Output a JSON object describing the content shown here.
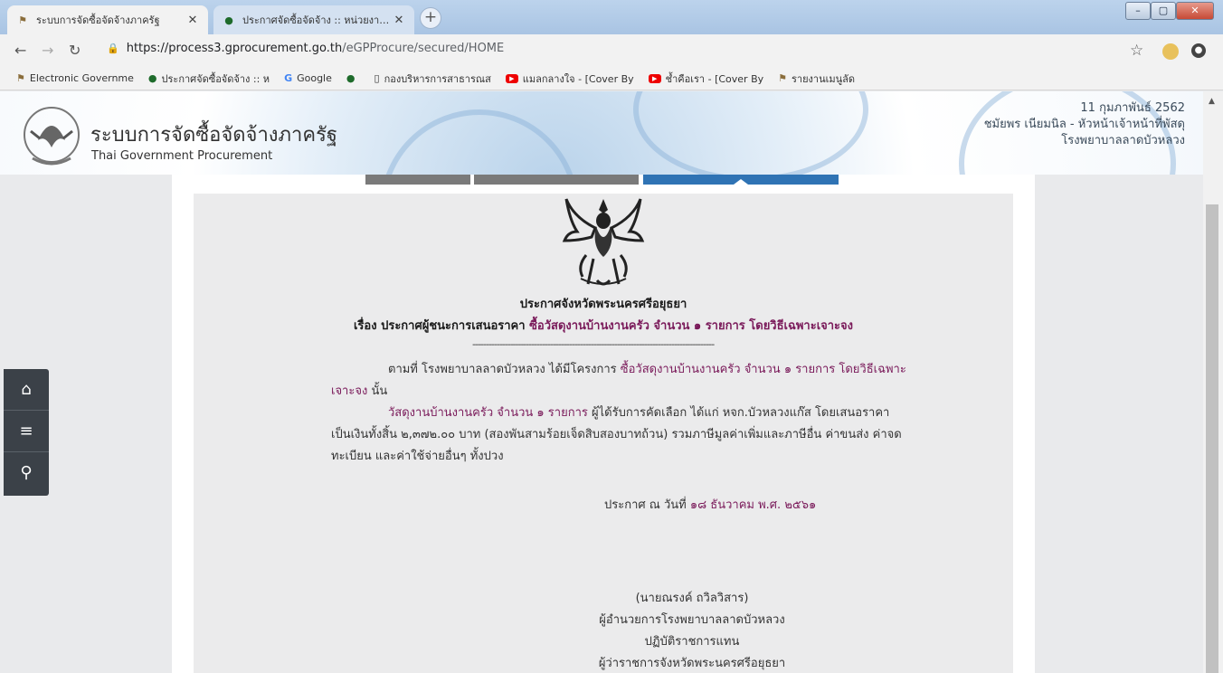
{
  "browser": {
    "tabs": [
      {
        "title": "ระบบการจัดซื้อจัดจ้างภาครัฐ",
        "active": true
      },
      {
        "title": "ประกาศจัดซื้อจัดจ้าง :: หน่วยงานในสังกั",
        "active": false
      }
    ],
    "url_host": "https://process3.gprocurement.go.th",
    "url_path": "/eGPProcure/secured/HOME",
    "window_min": "–",
    "window_max": "▢",
    "window_close": "✕"
  },
  "bookmarks": [
    {
      "label": "Electronic Governme",
      "icon": "egp-icon"
    },
    {
      "label": "ประกาศจัดซื้อจัดจ้าง :: ห",
      "icon": "green-shield-icon"
    },
    {
      "label": "Google",
      "icon": "google-icon"
    },
    {
      "label": "",
      "icon": "green-shield-icon"
    },
    {
      "label": "กองบริหารการสาธารณส",
      "icon": "page-icon"
    },
    {
      "label": "แมลกลางใจ - [Cover By",
      "icon": "youtube-icon"
    },
    {
      "label": "ช้ำคือเรา - [Cover By",
      "icon": "youtube-icon"
    },
    {
      "label": "รายงานเมนูลัด",
      "icon": "egp-icon"
    }
  ],
  "header": {
    "site_title": "ระบบการจัดซื้อจัดจ้างภาครัฐ",
    "site_subtitle": "Thai Government Procurement",
    "date": "11 กุมภาพันธ์ 2562",
    "user": "ชมัยพร เนียมนิล - หัวหน้าเจ้าหน้าที่พัสดุ",
    "org": "โรงพยาบาลลาดบัวหลวง"
  },
  "document": {
    "heading": "ประกาศจังหวัดพระนครศรีอยุธยา",
    "subject_prefix": "เรื่อง ประกาศผู้ชนะการเสนอราคา",
    "subject_highlight": "ซื้อวัสดุงานบ้านงานครัว จำนวน ๑ รายการ โดยวิธีเฉพาะเจาะจง",
    "dashes": "------------------------------------------------------------------------------------------",
    "para1_line1_prefix": "ตามที่ โรงพยาบาลลาดบัวหลวง ได้มีโครงการ",
    "para1_line1_highlight": "ซื้อวัสดุงานบ้านงานครัว จำนวน ๑ รายการ โดยวิธีเฉพาะ",
    "para1_line2_highlight": "เจาะจง",
    "para1_line2_suffix": "นั้น",
    "para2_line1_highlight": "วัสดุงานบ้านงานครัว จำนวน ๑ รายการ",
    "para2_line1_suffix": "ผู้ได้รับการคัดเลือก ได้แก่ หจก.บัวหลวงแก๊ส โดยเสนอราคา",
    "para2_line2": "เป็นเงินทั้งสิ้น ๒,๓๗๒.๐๐ บาท (สองพันสามร้อยเจ็ดสิบสองบาทถ้วน) รวมภาษีมูลค่าเพิ่มและภาษีอื่น ค่าขนส่ง ค่าจด",
    "para2_line3": "ทะเบียน และค่าใช้จ่ายอื่นๆ ทั้งปวง",
    "announce_prefix": "ประกาศ ณ วันที่",
    "announce_date": "๑๘ ธันวาคม พ.ศ. ๒๕๖๑",
    "signer_name": "(นายณรงค์ ถวิลวิสาร)",
    "signer_title1": "ผู้อำนวยการโรงพยาบาลลาดบัวหลวง",
    "signer_title2": "ปฏิบัติราชการแทน",
    "signer_title3": "ผู้ว่าราชการจังหวัดพระนครศรีอยุธยา"
  },
  "sidenav": {
    "items": [
      {
        "icon": "home-icon",
        "glyph": "⌂"
      },
      {
        "icon": "menu-icon",
        "glyph": "≡"
      },
      {
        "icon": "search-icon",
        "glyph": "⚲"
      }
    ]
  },
  "colors": {
    "highlight": "#7a1a5a",
    "tab_blue": "#2f73b4",
    "tab_gray": "#7a7a7a",
    "sidenav": "#3b4148"
  }
}
